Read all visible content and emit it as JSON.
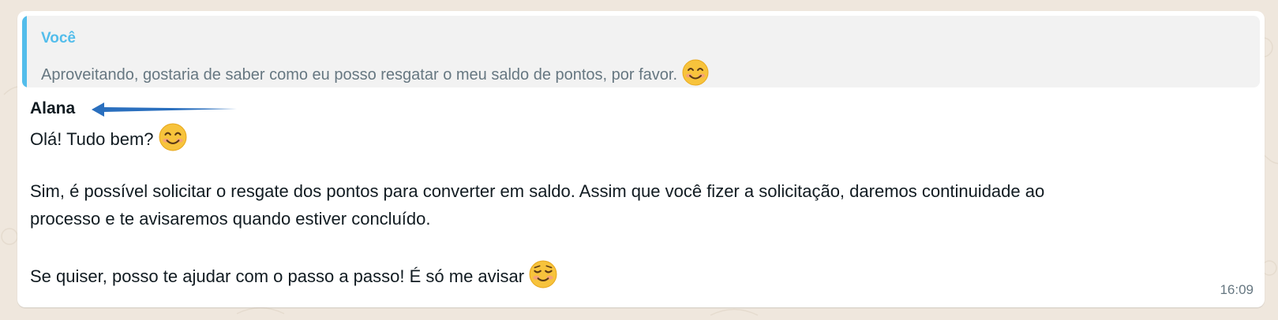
{
  "quoted": {
    "author": "Você",
    "text": "Aproveitando, gostaria de saber como eu posso resgatar o meu saldo de pontos, por favor.",
    "emoji": "smiling-face-icon"
  },
  "message": {
    "sender": "Alana",
    "line1": "Olá! Tudo bem?",
    "line2": "Sim, é possível solicitar o resgate dos pontos para converter em saldo. Assim que você fizer a solicitação, daremos continuidade ao",
    "line3": "processo e te avisaremos quando estiver concluído.",
    "line4": "Se quiser, posso te ajudar com o passo a passo! É só me avisar",
    "time": "16:09"
  },
  "colors": {
    "background": "#efe7dd",
    "bubble": "#ffffff",
    "quote_bar": "#53bdeb",
    "quote_author": "#53bdeb",
    "arrow": "#2a6fbe"
  }
}
